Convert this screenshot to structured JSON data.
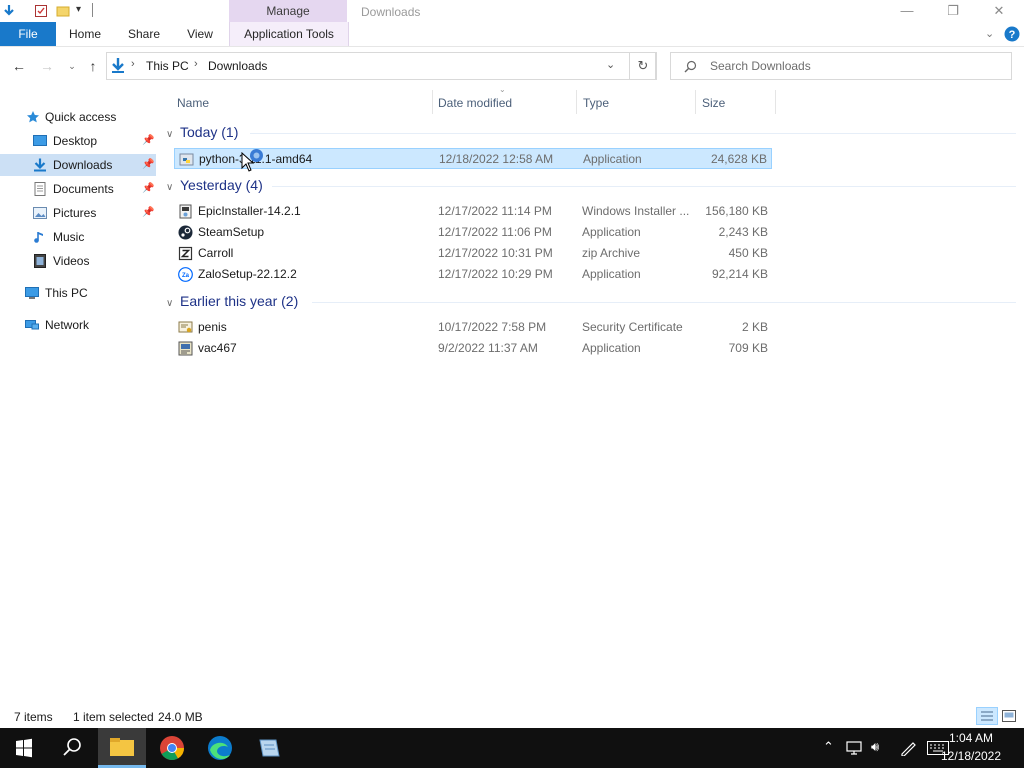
{
  "window": {
    "title": "Downloads",
    "manage_label": "Manage",
    "minimize": "—",
    "maximize": "❐",
    "close": "✕"
  },
  "ribbon": {
    "file": "File",
    "home": "Home",
    "share": "Share",
    "view": "View",
    "app_tools": "Application Tools"
  },
  "address": {
    "crumbs": [
      "This PC",
      "Downloads"
    ],
    "search_placeholder": "Search Downloads"
  },
  "nav": {
    "items": [
      {
        "label": "Quick access",
        "icon": "star-icon"
      },
      {
        "label": "Desktop",
        "icon": "desktop-icon",
        "pinned": true
      },
      {
        "label": "Downloads",
        "icon": "download-icon",
        "pinned": true,
        "selected": true
      },
      {
        "label": "Documents",
        "icon": "documents-icon",
        "pinned": true
      },
      {
        "label": "Pictures",
        "icon": "pictures-icon",
        "pinned": true
      },
      {
        "label": "Music",
        "icon": "music-icon"
      },
      {
        "label": "Videos",
        "icon": "videos-icon"
      },
      {
        "label": "This PC",
        "icon": "computer-icon"
      },
      {
        "label": "Network",
        "icon": "network-icon"
      }
    ]
  },
  "columns": {
    "name": "Name",
    "date": "Date modified",
    "type": "Type",
    "size": "Size"
  },
  "groups": [
    {
      "label": "Today (1)",
      "files": [
        {
          "name": "python-3.11.1-amd64",
          "date": "12/18/2022 12:58 AM",
          "type": "Application",
          "size": "24,628 KB",
          "icon": "python-installer-icon",
          "selected": true
        }
      ]
    },
    {
      "label": "Yesterday (4)",
      "files": [
        {
          "name": "EpicInstaller-14.2.1",
          "date": "12/17/2022 11:14 PM",
          "type": "Windows Installer ...",
          "size": "156,180 KB",
          "icon": "msi-icon"
        },
        {
          "name": "SteamSetup",
          "date": "12/17/2022 11:06 PM",
          "type": "Application",
          "size": "2,243 KB",
          "icon": "steam-icon"
        },
        {
          "name": "Carroll",
          "date": "12/17/2022 10:31 PM",
          "type": "zip Archive",
          "size": "450 KB",
          "icon": "zip-icon"
        },
        {
          "name": "ZaloSetup-22.12.2",
          "date": "12/17/2022 10:29 PM",
          "type": "Application",
          "size": "92,214 KB",
          "icon": "zalo-icon"
        }
      ]
    },
    {
      "label": "Earlier this year (2)",
      "files": [
        {
          "name": "penis",
          "date": "10/17/2022 7:58 PM",
          "type": "Security Certificate",
          "size": "2 KB",
          "icon": "certificate-icon"
        },
        {
          "name": "vac467",
          "date": "9/2/2022 11:37 AM",
          "type": "Application",
          "size": "709 KB",
          "icon": "application-icon"
        }
      ]
    }
  ],
  "status": {
    "items": "7 items",
    "selected": "1 item selected",
    "size": "24.0 MB"
  },
  "taskbar": {
    "time": "1:04 AM",
    "date": "12/18/2022"
  },
  "colors": {
    "accent": "#1979ca",
    "selection": "#cce8ff",
    "manage_tab": "#e5d7f0",
    "group_header": "#1e3287",
    "taskbar": "#101010"
  }
}
